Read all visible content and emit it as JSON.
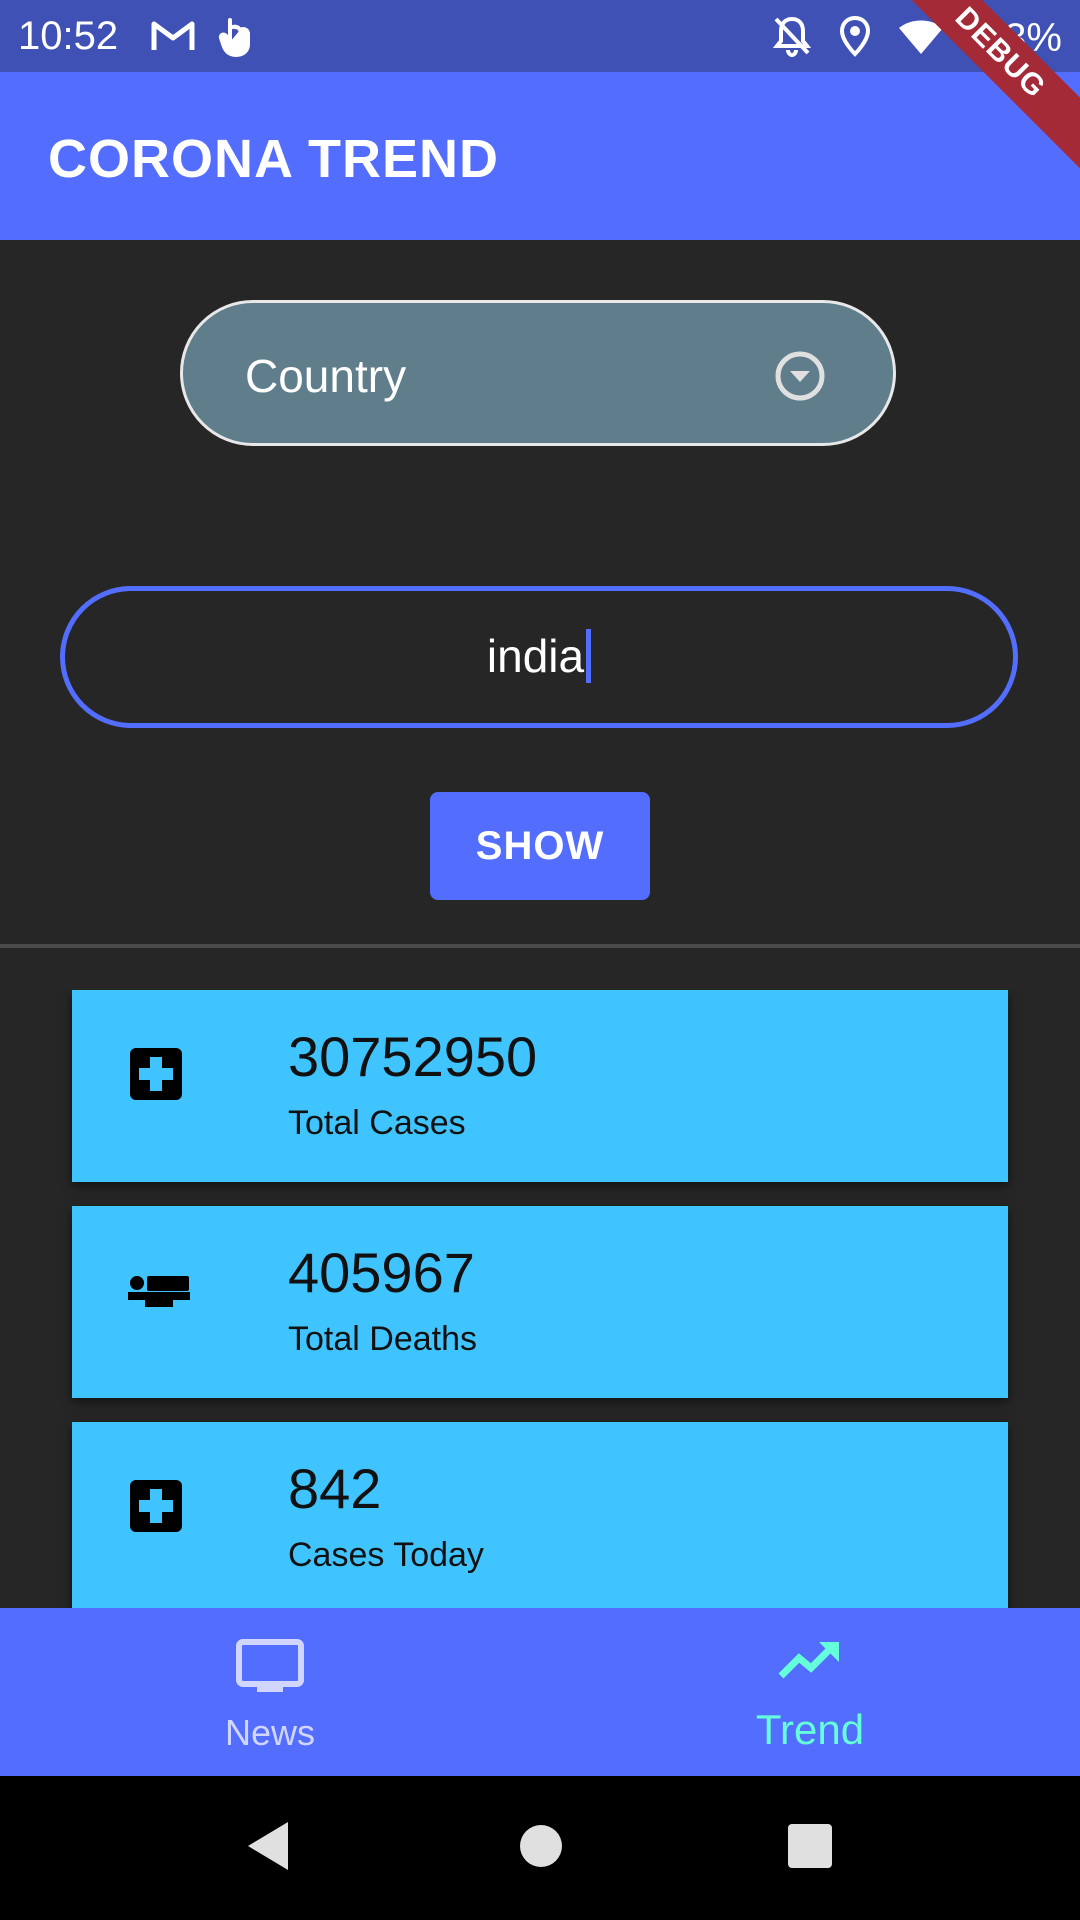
{
  "status_bar": {
    "time": "10:52",
    "battery": "3%",
    "left_icons": [
      "gmail-icon",
      "touch-icon"
    ],
    "right_icons": [
      "notifications-off-icon",
      "location-icon",
      "wifi-icon",
      "battery-charging-icon"
    ]
  },
  "app_bar": {
    "title": "CORONA TREND",
    "debug_banner": "DEBUG"
  },
  "dropdown": {
    "label": "Country",
    "icon": "dropdown-circle-icon"
  },
  "search": {
    "value": "india"
  },
  "show_button": {
    "label": "SHOW"
  },
  "stats": [
    {
      "icon": "medical-cross-icon",
      "value": "30752950",
      "label": "Total Cases"
    },
    {
      "icon": "hotel-bed-icon",
      "value": "405967",
      "label": "Total Deaths"
    },
    {
      "icon": "medical-cross-icon",
      "value": "842",
      "label": "Cases Today"
    }
  ],
  "bottom_nav": {
    "items": [
      {
        "label": "News",
        "icon": "tv-icon",
        "active": false
      },
      {
        "label": "Trend",
        "icon": "trending-up-icon",
        "active": true
      }
    ]
  },
  "colors": {
    "status_bar": "#3f51b5",
    "primary": "#536dfe",
    "background": "#262626",
    "dropdown": "#607d8b",
    "card": "#40c4ff",
    "active_nav": "#64ffda",
    "debug": "#a52a38"
  }
}
